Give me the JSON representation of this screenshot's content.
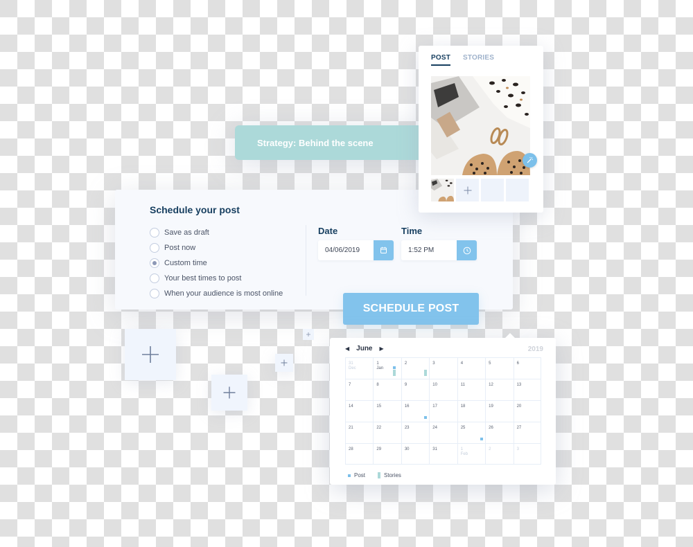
{
  "strategy": {
    "label": "Strategy: Behind the scene"
  },
  "post_panel": {
    "tabs": [
      {
        "label": "POST",
        "active": true
      },
      {
        "label": "STORIES",
        "active": false
      }
    ],
    "magic_icon": "magic-wand-icon",
    "add_icon": "plus-icon"
  },
  "schedule": {
    "title": "Schedule your post",
    "options": [
      {
        "label": "Save as draft",
        "checked": false
      },
      {
        "label": "Post now",
        "checked": false
      },
      {
        "label": "Custom time",
        "checked": true
      },
      {
        "label": "Your best times to post",
        "checked": false
      },
      {
        "label": "When your audience is most online",
        "checked": false
      }
    ],
    "date_label": "Date",
    "date_value": "04/06/2019",
    "date_icon": "calendar-icon",
    "time_label": "Time",
    "time_value": "1:52 PM",
    "time_icon": "clock-icon",
    "submit_label": "SCHEDULE POST"
  },
  "calendar": {
    "month": "June",
    "year": "2019",
    "prev_icon": "caret-left-icon",
    "next_icon": "caret-right-icon",
    "weeks": [
      [
        {
          "d": "31",
          "sub": "Dec",
          "muted": true
        },
        {
          "d": "1",
          "sub": "Jan",
          "post": true,
          "story": true
        },
        {
          "d": "2",
          "story": true
        },
        {
          "d": "3"
        },
        {
          "d": "4"
        },
        {
          "d": "5"
        },
        {
          "d": "6"
        }
      ],
      [
        {
          "d": "7"
        },
        {
          "d": "8"
        },
        {
          "d": "9"
        },
        {
          "d": "10"
        },
        {
          "d": "11"
        },
        {
          "d": "12"
        },
        {
          "d": "13"
        }
      ],
      [
        {
          "d": "14"
        },
        {
          "d": "15"
        },
        {
          "d": "16",
          "post": true
        },
        {
          "d": "17"
        },
        {
          "d": "18"
        },
        {
          "d": "19"
        },
        {
          "d": "20"
        }
      ],
      [
        {
          "d": "21"
        },
        {
          "d": "22"
        },
        {
          "d": "23"
        },
        {
          "d": "24"
        },
        {
          "d": "25",
          "post": true
        },
        {
          "d": "26"
        },
        {
          "d": "27"
        }
      ],
      [
        {
          "d": "28"
        },
        {
          "d": "29"
        },
        {
          "d": "30"
        },
        {
          "d": "31"
        },
        {
          "d": "1",
          "sub": "Feb",
          "muted": true
        },
        {
          "d": "2",
          "muted": true
        },
        {
          "d": "3",
          "muted": true
        }
      ]
    ],
    "legend": {
      "post": "Post",
      "stories": "Stories"
    }
  },
  "colors": {
    "accent_blue": "#82c3ec",
    "teal": "#acd9d9",
    "navy": "#163e5f"
  }
}
